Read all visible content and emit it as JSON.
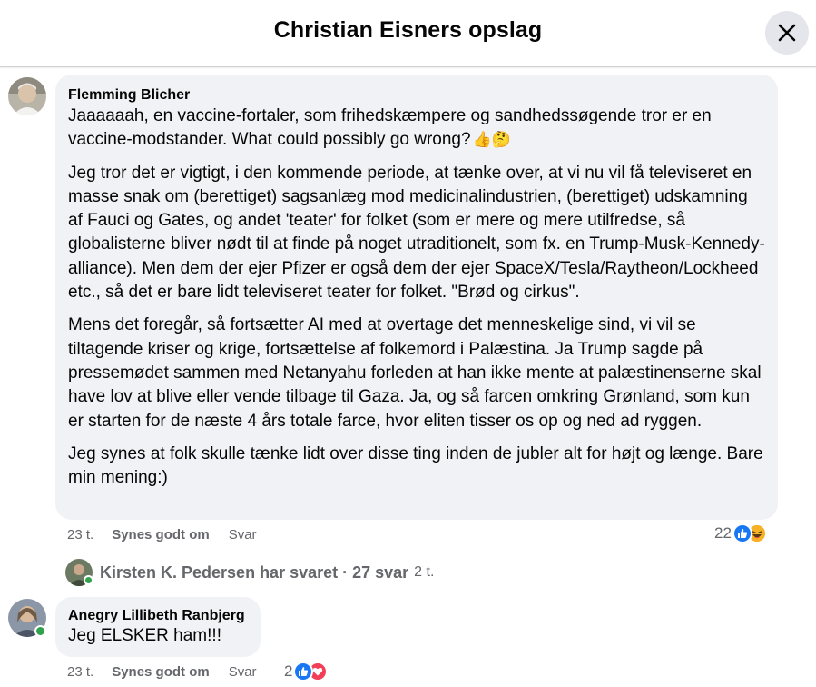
{
  "header": {
    "title": "Christian Eisners opslag"
  },
  "comment1": {
    "author": "Flemming Blicher",
    "paragraphs": [
      "Jaaaaaah, en vaccine-fortaler, som frihedskæmpere og sandhedssøgende tror er en vaccine-modstander. What could possibly go wrong?",
      "Jeg tror det er vigtigt, i den kommende periode, at tænke over, at vi nu vil få televiseret en masse snak om (berettiget) sagsanlæg mod medicinalindustrien, (berettiget) udskamning af Fauci og Gates, og andet 'teater' for folket (som er mere og mere utilfredse, så globalisterne bliver nødt til at finde på noget utraditionelt, som fx. en Trump-Musk-Kennedy-alliance). Men dem der ejer Pfizer er også dem der ejer SpaceX/Tesla/Raytheon/Lockheed etc., så det er bare lidt televiseret teater for folket. \"Brød og cirkus\".",
      "Mens det foregår, så fortsætter AI med at overtage det menneskelige sind, vi vil se tiltagende kriser og krige, fortsættelse af folkemord i Palæstina. Ja Trump sagde på pressemødet sammen med Netanyahu forleden at han ikke mente at palæstinenserne skal have lov at blive eller vende tilbage til Gaza. Ja, og så farcen omkring Grønland, som kun er starten for de næste 4 års totale farce, hvor eliten tisser os op og ned ad ryggen.",
      "Jeg synes at folk skulle tænke lidt over disse ting inden de jubler alt for højt og længe. Bare min mening:)"
    ],
    "emojis": "👍🤔",
    "time": "23 t.",
    "like_label": "Synes godt om",
    "reply_label": "Svar",
    "reaction_count": "22",
    "reaction_icons": [
      "like-icon",
      "laughing-emoji-icon"
    ]
  },
  "replies": {
    "text": "Kirsten K. Pedersen har svaret · 27 svar",
    "time": "2 t."
  },
  "comment2": {
    "author": "Anegry Lillibeth Ranbjerg",
    "text": "Jeg ELSKER ham!!!",
    "time": "23 t.",
    "like_label": "Synes godt om",
    "reply_label": "Svar",
    "reaction_count": "2",
    "reaction_icons": [
      "like-icon",
      "love-icon"
    ]
  },
  "colors": {
    "like_blue": "#1877f2",
    "love_red": "#f33e58",
    "bubble_bg": "#f0f2f5",
    "secondary_text": "#65676b",
    "online_green": "#31a24c"
  }
}
